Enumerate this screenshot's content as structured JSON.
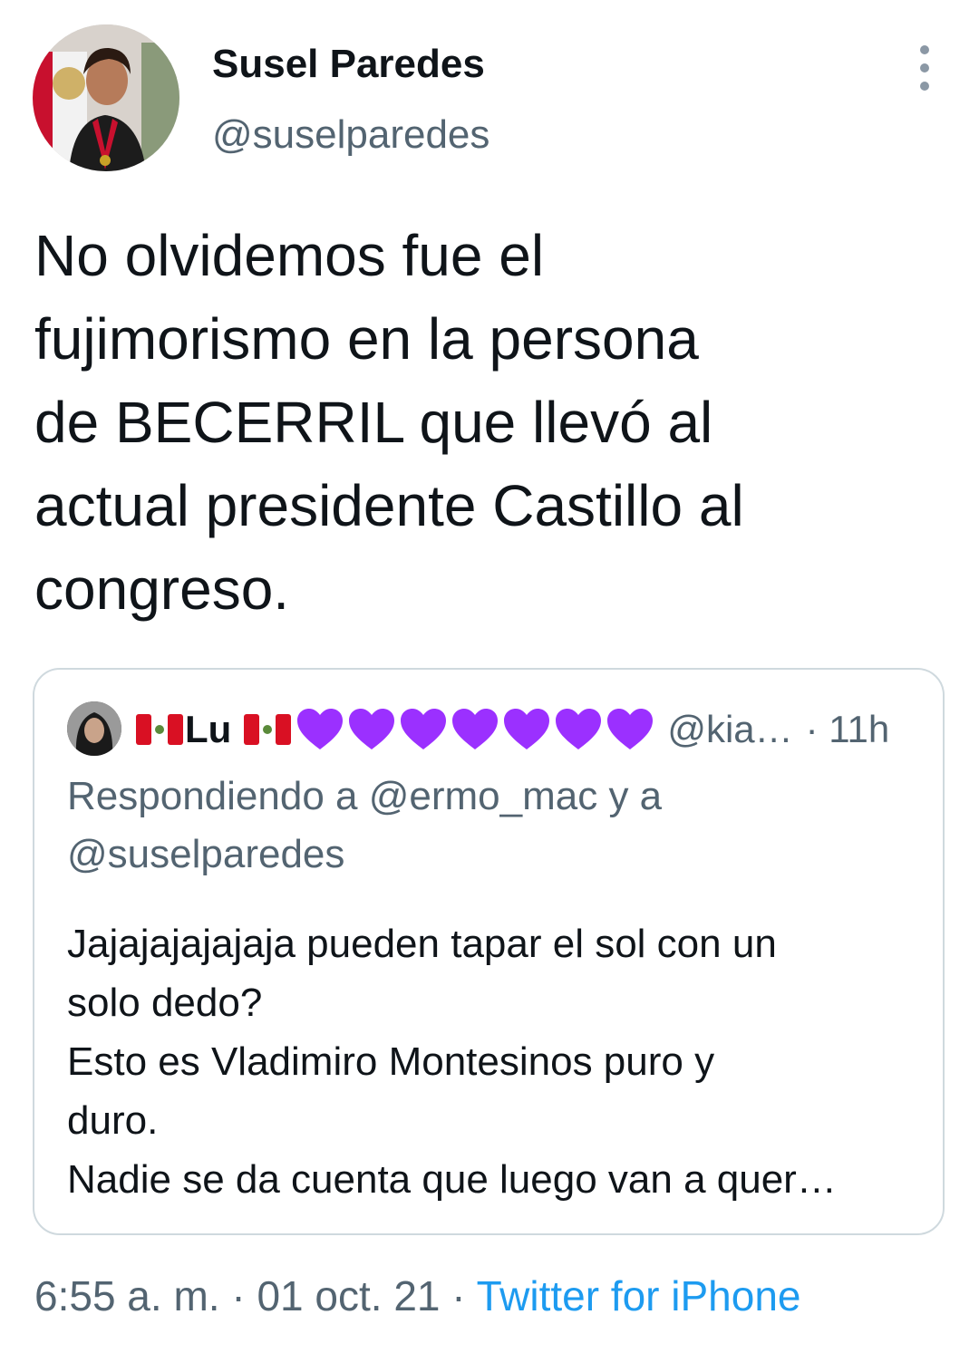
{
  "author": {
    "name": "Susel Paredes",
    "handle": "@suselparedes"
  },
  "tweet": {
    "text": "No olvidemos fue el\nfujimorismo en la persona\nde BECERRIL que llevó al\nactual presidente Castillo al\ncongreso."
  },
  "quoted": {
    "name": "Lu",
    "heart_count": 7,
    "handle": "@kia…",
    "time": "· 11h",
    "replying_to": "Respondiendo a @ermo_mac y a @suselparedes",
    "text": "Jajajajajajaja pueden tapar el sol con un\nsolo dedo?\nEsto es Vladimiro Montesinos puro y\nduro.\nNadie se da cuenta que luego van a quer…"
  },
  "meta": {
    "time": "6:55 a. m.",
    "sep1": " · ",
    "date": "01 oct. 21",
    "sep2": " · ",
    "source": "Twitter for iPhone"
  },
  "colors": {
    "accent": "#1d9bf0",
    "secondary": "#536471",
    "heart": "#9b30ff",
    "flag_red": "#d91023"
  },
  "icons": {
    "more": "more-vertical-icon",
    "heart": "purple-heart-icon",
    "flag": "peru-flag-icon"
  }
}
